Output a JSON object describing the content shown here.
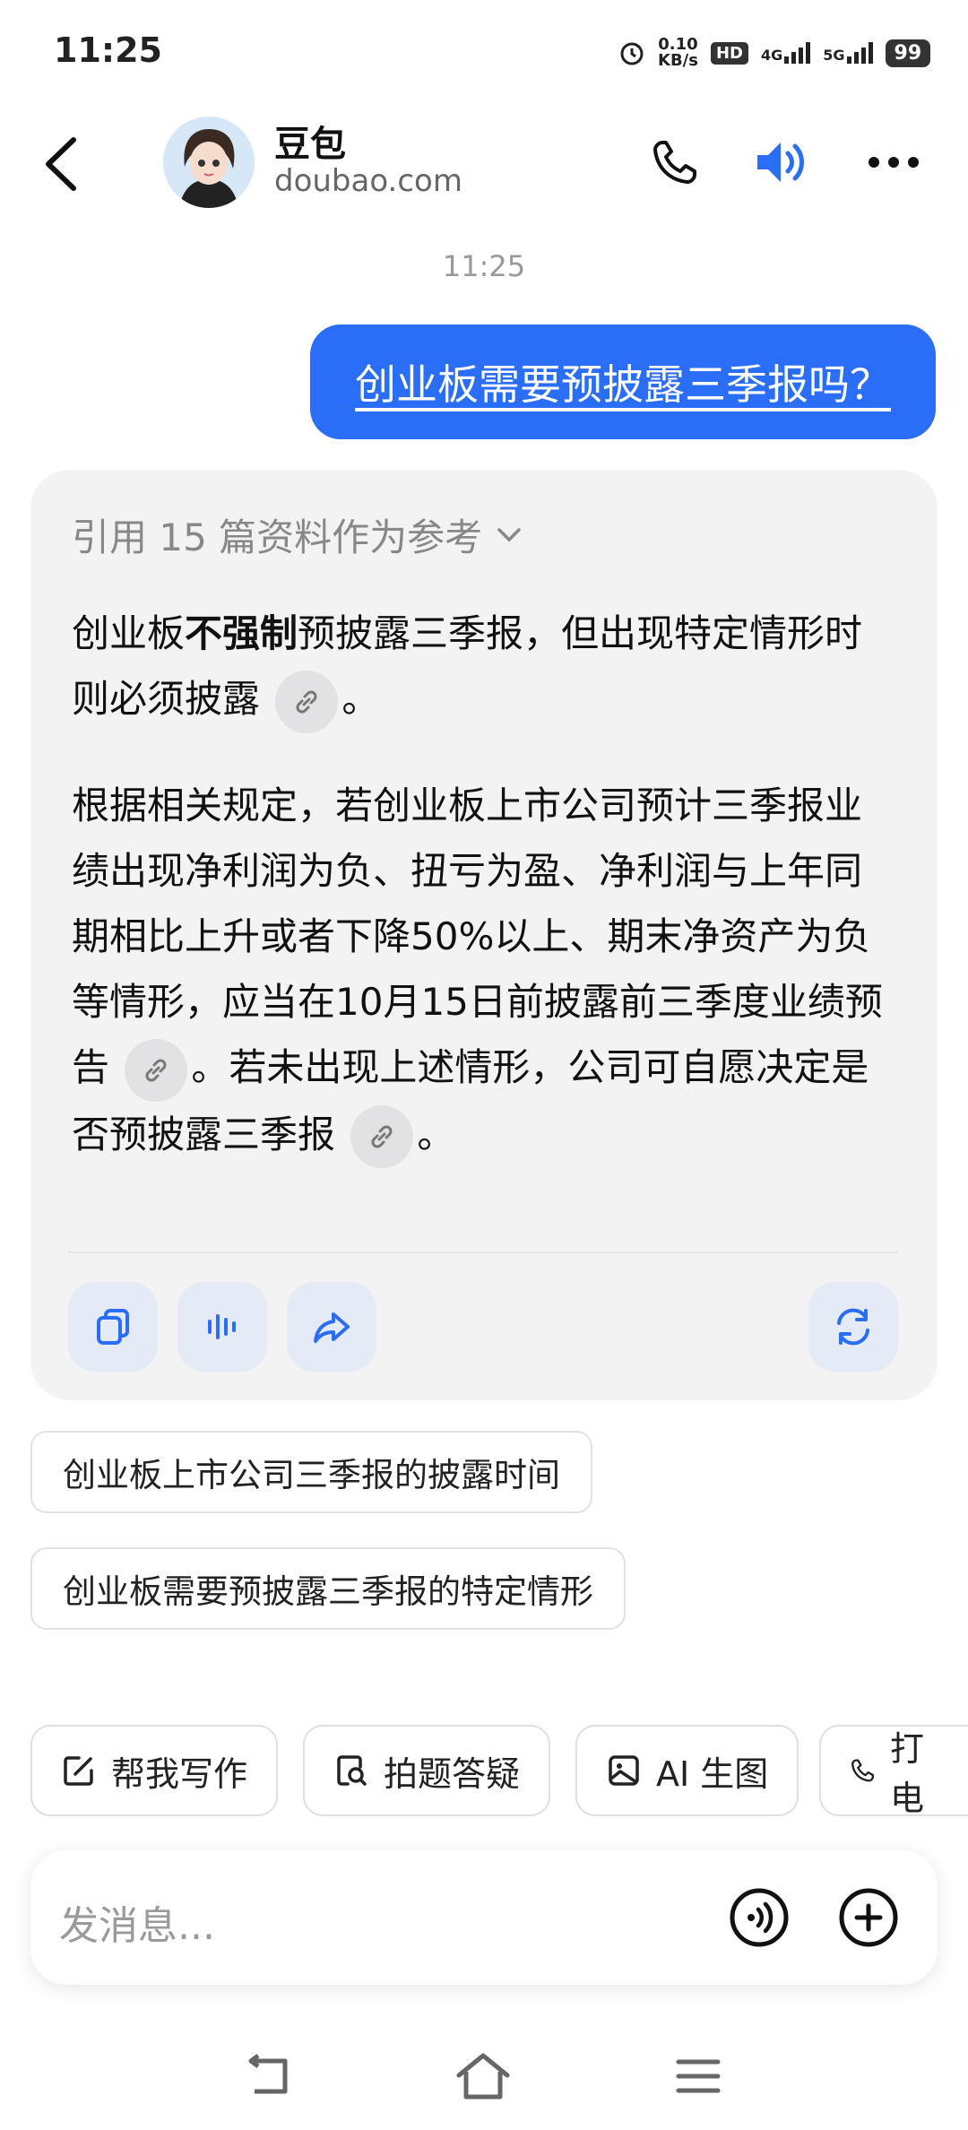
{
  "status_bar": {
    "time": "11:25",
    "net_speed_value": "0.10",
    "net_speed_unit": "KB/s",
    "hd": "HD",
    "sim1": "4G",
    "sim2": "5G",
    "battery": "99"
  },
  "header": {
    "name": "豆包",
    "domain": "doubao.com"
  },
  "chat": {
    "timestamp": "11:25",
    "user_message": "创业板需要预披露三季报吗？",
    "reference": "引用 15 篇资料作为参考",
    "para1": {
      "pre": "创业板",
      "bold": "不强制",
      "post": "预披露三季报，但出现特定情形时则必须披露",
      "end": "。"
    },
    "para2": {
      "text1": "根据相关规定，若创业板上市公司预计三季报业绩出现净利润为负、扭亏为盈、净利润与上年同期相比上升或者下降50%以上、期末净资产为负等情形，应当在10月15日前披露前三季度业绩预告",
      "text2": "。若未出现上述情形，公司可自愿决定是否预披露三季报",
      "end": "。"
    }
  },
  "suggestions": [
    "创业板上市公司三季报的披露时间",
    "创业板需要预披露三季报的特定情形"
  ],
  "quick_actions": [
    "帮我写作",
    "拍题答疑",
    "AI 生图",
    "打电"
  ],
  "input": {
    "placeholder": "发消息..."
  },
  "colors": {
    "accent": "#2a6df7",
    "card_bg": "#f3f3f4",
    "action_bg": "#e4ebf7"
  }
}
